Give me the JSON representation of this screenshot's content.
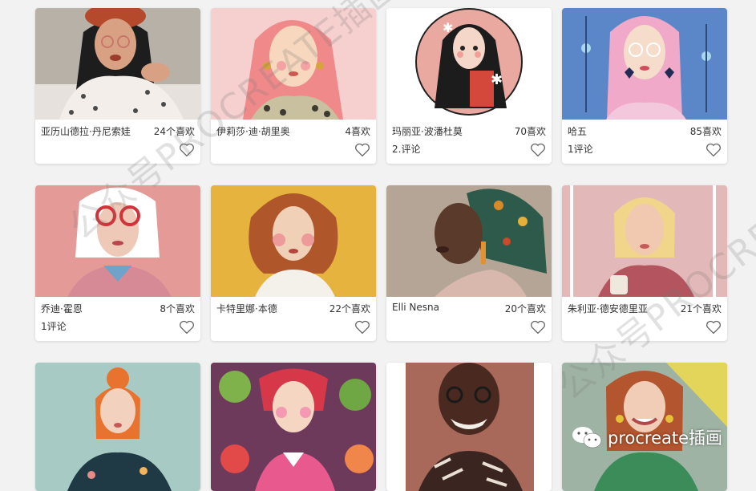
{
  "cards": [
    {
      "title": "亚历山德拉·丹尼索娃",
      "likes": "24个喜欢",
      "comments": ""
    },
    {
      "title": "伊莉莎·迪·胡里奥",
      "likes": "4喜欢",
      "comments": ""
    },
    {
      "title": "玛丽亚·波潘杜莫",
      "likes": "70喜欢",
      "comments": "2.评论"
    },
    {
      "title": "哈五",
      "likes": "85喜欢",
      "comments": "1评论"
    },
    {
      "title": "乔迪·霍恩",
      "likes": "8个喜欢",
      "comments": "1评论"
    },
    {
      "title": "卡特里娜·本德",
      "likes": "22个喜欢",
      "comments": ""
    },
    {
      "title": "Elli Nesna",
      "likes": "20个喜欢",
      "comments": ""
    },
    {
      "title": "朱利亚·德安德里亚",
      "likes": "21个喜欢",
      "comments": ""
    }
  ],
  "watermark": {
    "text": "公众号PROCREATE插画"
  },
  "brand": {
    "text": "procreate插画",
    "icon": "wechat-icon"
  },
  "colors": {
    "background": "#f2f2f2",
    "card": "#ffffff",
    "text": "#333333"
  }
}
